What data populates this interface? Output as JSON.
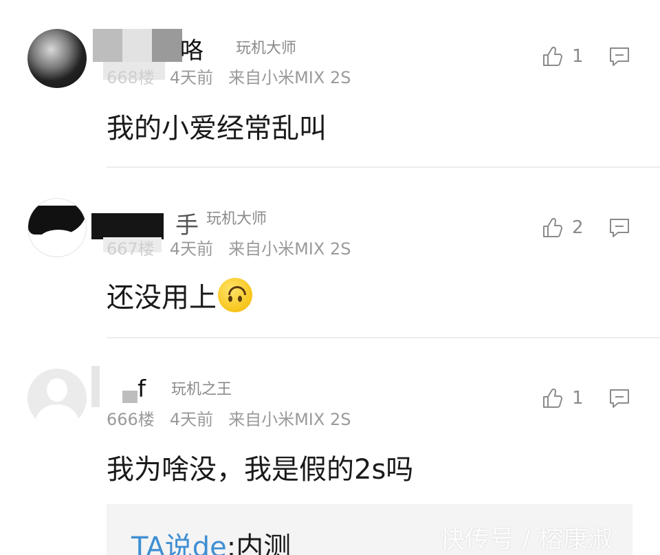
{
  "comments": [
    {
      "username_visible": "咯",
      "badge": "玩机大师",
      "floor": "668楼",
      "time": "4天前",
      "device": "来自小米MIX 2S",
      "likes": "1",
      "content": "我的小爱经常乱叫"
    },
    {
      "username_visible": "手",
      "badge": "玩机大师",
      "floor": "667楼",
      "time": "4天前",
      "device": "来自小米MIX 2S",
      "likes": "2",
      "content": "还没用上",
      "emoji": "upside-down-face"
    },
    {
      "username_visible": "f",
      "badge": "玩机之王",
      "floor": "666楼",
      "time": "4天前",
      "device": "来自小米MIX 2S",
      "likes": "1",
      "content": "我为啥没，我是假的2s吗"
    }
  ],
  "sub_reply": {
    "user": "TA说de",
    "separator": ":",
    "text": "内测"
  },
  "watermark": "快传号 / 榕康淑",
  "icons": {
    "like": "thumbs-up-icon",
    "reply": "comment-icon"
  },
  "colors": {
    "link_blue": "#3f8fd3",
    "meta_gray": "#9a9a9a"
  }
}
